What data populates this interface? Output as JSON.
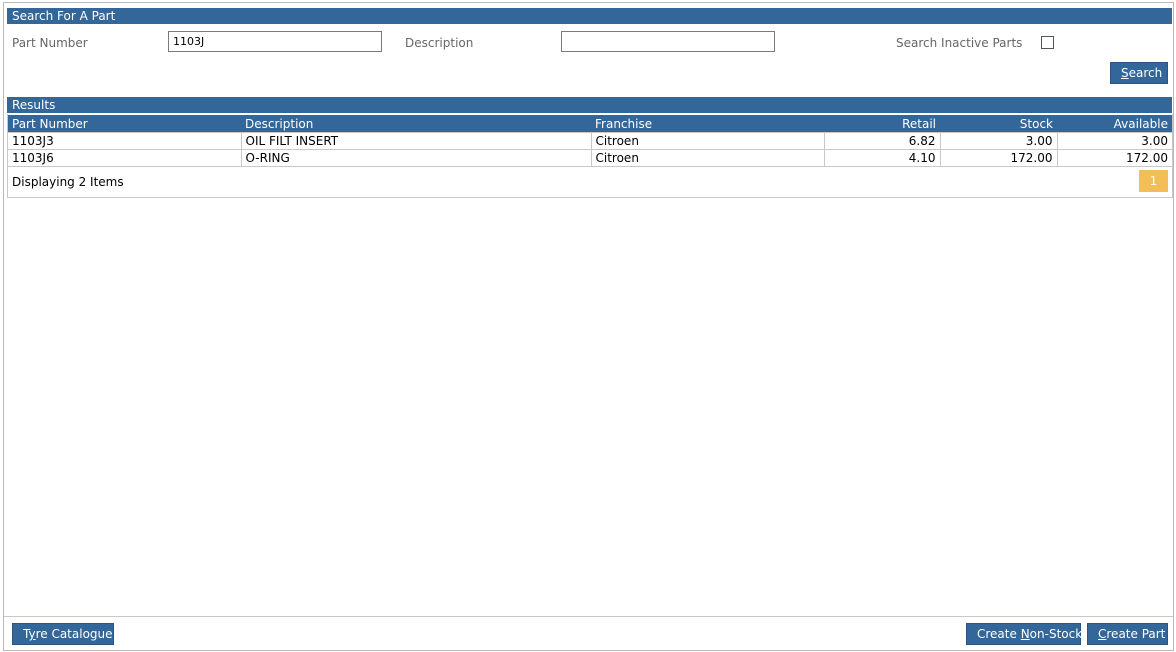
{
  "search_panel": {
    "header": "Search For A Part",
    "part_number_label": "Part Number",
    "part_number_value": "1103J",
    "description_label": "Description",
    "description_value": "",
    "inactive_label": "Search Inactive Parts",
    "inactive_checked": false,
    "search_button": {
      "pre": "",
      "accel": "S",
      "post": "earch"
    }
  },
  "results": {
    "header": "Results",
    "columns": [
      "Part Number",
      "Description",
      "Franchise",
      "Retail",
      "Stock",
      "Available"
    ],
    "rows": [
      {
        "part_number": "1103J3",
        "description": "OIL FILT INSERT",
        "franchise": "Citroen",
        "retail": "6.82",
        "stock": "3.00",
        "available": "3.00"
      },
      {
        "part_number": "1103J6",
        "description": "O-RING",
        "franchise": "Citroen",
        "retail": "4.10",
        "stock": "172.00",
        "available": "172.00"
      }
    ],
    "count_text": "Displaying 2 Items",
    "page": "1"
  },
  "footer": {
    "tyre_button": {
      "pre": "T",
      "accel": "y",
      "post": "re Catalogue"
    },
    "non_stock_button": {
      "pre": "Create ",
      "accel": "N",
      "post": "on-Stock"
    },
    "create_part_button": {
      "pre": "",
      "accel": "C",
      "post": "reate Part"
    }
  },
  "colors": {
    "header": "#336699",
    "page_active": "#f3bd5a"
  }
}
